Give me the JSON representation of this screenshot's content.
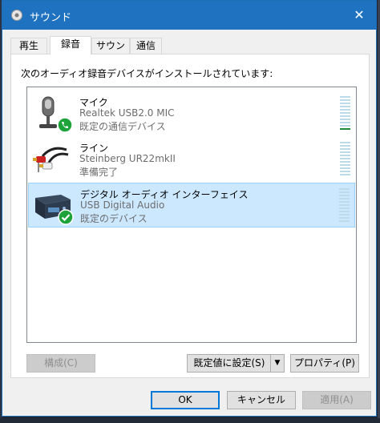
{
  "window": {
    "title": "サウンド",
    "close_label": "✕"
  },
  "tabs": [
    {
      "label": "再生",
      "active": false
    },
    {
      "label": "録音",
      "active": true
    },
    {
      "label": "サウンド",
      "active": false
    },
    {
      "label": "通信",
      "active": false
    }
  ],
  "panel": {
    "caption": "次のオーディオ録音デバイスがインストールされています:"
  },
  "devices": [
    {
      "icon": "microphone-icon",
      "badge": "phone-badge-icon",
      "name": "マイク",
      "driver": "Realtek USB2.0 MIC",
      "status": "既定の通信デバイス",
      "selected": false,
      "meter_level": 0.05
    },
    {
      "icon": "rca-cable-icon",
      "badge": null,
      "name": "ライン",
      "driver": "Steinberg UR22mkII",
      "status": "準備完了",
      "selected": false,
      "meter_level": 0
    },
    {
      "icon": "audio-interface-icon",
      "badge": "check-badge-icon",
      "name": "デジタル オーディオ インターフェイス",
      "driver": "USB Digital Audio",
      "status": "既定のデバイス",
      "selected": true,
      "meter_level": 0
    }
  ],
  "buttons": {
    "configure": "構成(C)",
    "set_default": "既定値に設定(S)",
    "properties": "プロパティ(P)",
    "ok": "OK",
    "cancel": "キャンセル",
    "apply": "適用(A)"
  },
  "colors": {
    "titlebar": "#1f72c0",
    "selection": "#cce8ff",
    "meter_active": "#1e8a3a",
    "badge_green": "#1ea33b"
  }
}
